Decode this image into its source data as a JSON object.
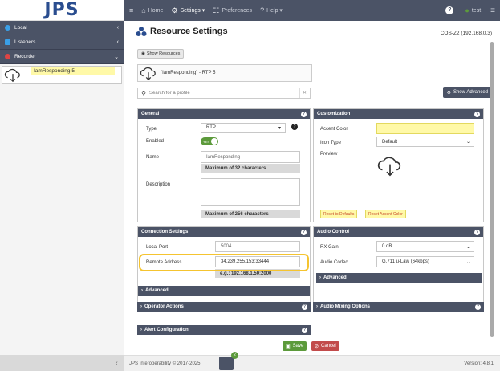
{
  "sidebar": {
    "logo": "JPS",
    "nav": [
      {
        "label": "Local",
        "color": "#3aa0e8"
      },
      {
        "label": "Listeners",
        "color": "#3aa0e8"
      },
      {
        "label": "Recorder",
        "color": "#d44"
      }
    ],
    "resource_label": "IamResponding 5",
    "collapse": "‹"
  },
  "topbar": {
    "home": "Home",
    "settings": "Settings",
    "preferences": "Preferences",
    "help": "Help",
    "user": "test"
  },
  "page": {
    "title": "Resource Settings",
    "server": "COS-Z2 (192.168.0.3)",
    "show_resources": "Show Resources",
    "resource_card": "\"IamResponding\" - RTP 5",
    "search_placeholder": "Search for a profile",
    "show_advanced": "Show Advanced"
  },
  "general": {
    "header": "General",
    "type_label": "Type",
    "type_value": "RTP",
    "enabled_label": "Enabled",
    "toggle": "YES",
    "name_label": "Name",
    "name_value": "IamResponding",
    "name_note": "Maximum of 32 characters",
    "desc_label": "Description",
    "desc_note": "Maximum of 256 characters"
  },
  "customization": {
    "header": "Customization",
    "accent_label": "Accent Color",
    "icon_label": "Icon Type",
    "icon_value": "Default",
    "preview_label": "Preview",
    "reset_defaults": "Reset to Defaults",
    "reset_accent": "Reset Accent Color"
  },
  "connection": {
    "header": "Connection Settings",
    "port_label": "Local Port",
    "port_value": "5004",
    "remote_label": "Remote Address",
    "remote_value": "34.239.255.153:33444",
    "remote_note": "e.g.: 192.168.1.50:2000",
    "advanced": "Advanced"
  },
  "audio": {
    "header": "Audio Control",
    "rx_label": "RX Gain",
    "rx_value": "0 dB",
    "codec_label": "Audio Codec",
    "codec_value": "G.711 u-Law (64kbps)",
    "advanced": "Advanced"
  },
  "sections": {
    "operator": "Operator Actions",
    "mixing": "Audio Mixing Options",
    "alert": "Alert Configuration"
  },
  "actions": {
    "save": "Save",
    "cancel": "Cancel"
  },
  "footer": {
    "copyright": "JPS Interoperability © 2017-2025",
    "version": "Version: 4.8.1",
    "badge": "2"
  }
}
